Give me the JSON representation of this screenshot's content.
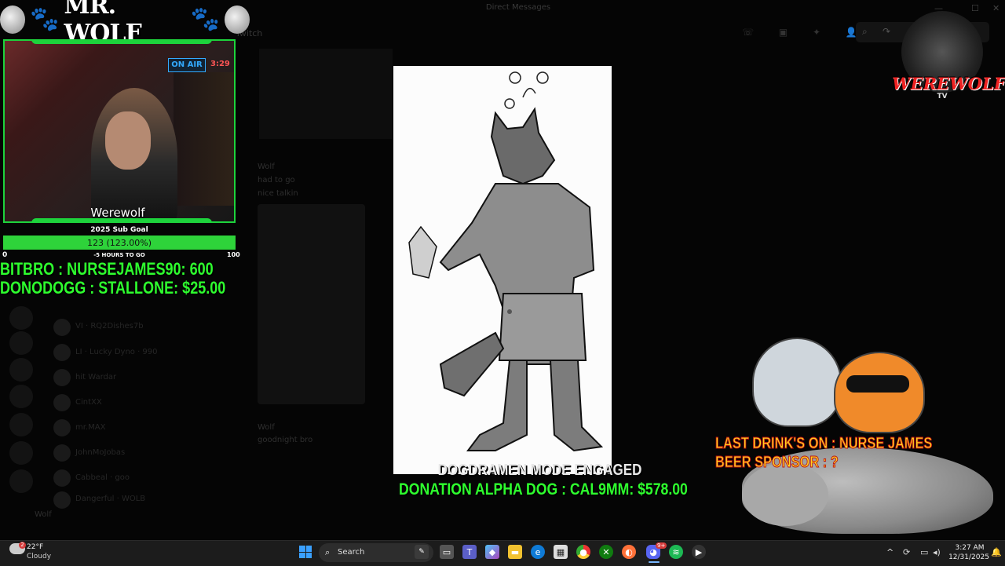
{
  "window": {
    "title": "Direct Messages"
  },
  "overlay": {
    "title": "MR. WOLF",
    "webcam_name": "Werewolf",
    "webcam_sign": "ON AIR",
    "webcam_clock": "3:29",
    "sub_goal": {
      "label": "2025 Sub Goal",
      "value_text": "123 (123.00%)",
      "progress_percent": 100,
      "min": "0",
      "max": "100",
      "time_left": "-5 HOURS TO GO"
    },
    "bitbro": "BITBRO : NURSEJAMES90: 600",
    "donodogg": "DONODOGG : STALLONE: $25.00",
    "boss_text": "DOGDRAMEN MODE ENGAGED",
    "donation": "DONATION ALPHA DOG : CAL9MM: $578.00",
    "last_drink": "LAST DRINK'S ON : NURSE JAMES",
    "beer_sponsor": "BEER SPONSOR : ?",
    "logo": {
      "text": "WEREWOLF",
      "sub": "TV"
    }
  },
  "discord": {
    "header_label": "Twitch",
    "messages": [
      {
        "author": "Wolf",
        "text": "had to go"
      },
      {
        "author": "",
        "text": "nice talkin"
      }
    ],
    "second_message": {
      "author": "Wolf",
      "text": "goodnight bro"
    },
    "channels": [
      "VI · RQ2Dishes7b",
      "LI · Lucky Dyno · 990",
      "hit Wardar",
      "CintXX",
      "mr.MAX",
      "JohnMoJobas",
      "Cabbeal · goo",
      "Dangerful · WOLB"
    ],
    "footer_user": "Wolf"
  },
  "taskbar": {
    "weather_temp": "22°F",
    "weather_desc": "Cloudy",
    "weather_badge": "2",
    "search_label": "Search",
    "time": "3:27 AM",
    "date": "12/31/2025",
    "discord_badge": "9+"
  },
  "colors": {
    "accent_green": "#2eff2e",
    "bar_green": "#2ed33a",
    "drink_yellow": "#ffd21f",
    "logo_red": "#e22222"
  }
}
